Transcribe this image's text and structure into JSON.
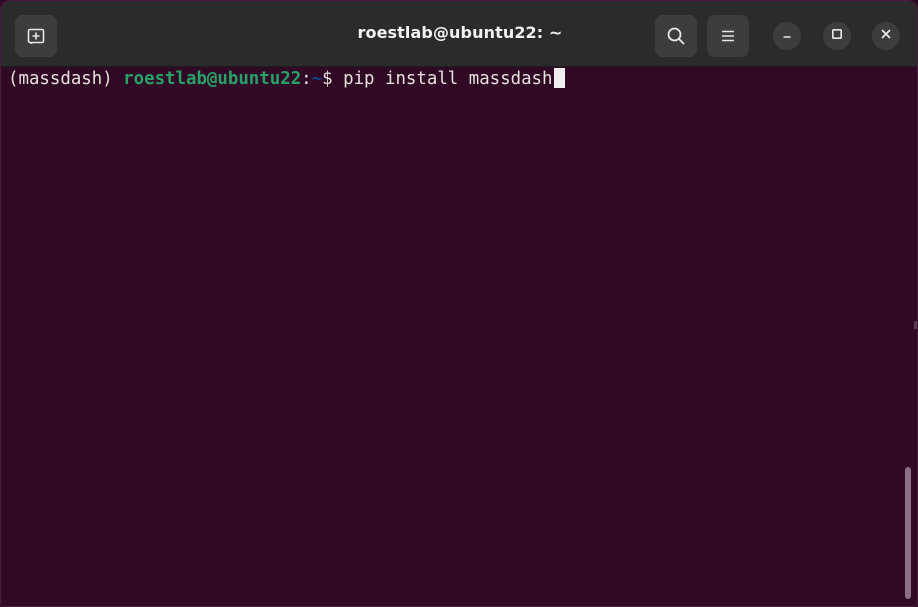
{
  "window": {
    "title": "roestlab@ubuntu22: ~"
  },
  "headerbar": {
    "new_tab_icon": "new-tab-icon",
    "search_icon": "search-icon",
    "menu_icon": "hamburger-menu-icon",
    "minimize_icon": "minimize-icon",
    "maximize_icon": "maximize-icon",
    "close_icon": "close-icon"
  },
  "terminal": {
    "env": "(massdash) ",
    "user_host": "roestlab@ubuntu22",
    "separator": ":",
    "path": "~",
    "prompt_symbol": "$ ",
    "command": "pip install massdash"
  },
  "colors": {
    "background": "#300a24",
    "user_host": "#26a269",
    "path": "#12488b",
    "text": "#e6e1dc"
  }
}
